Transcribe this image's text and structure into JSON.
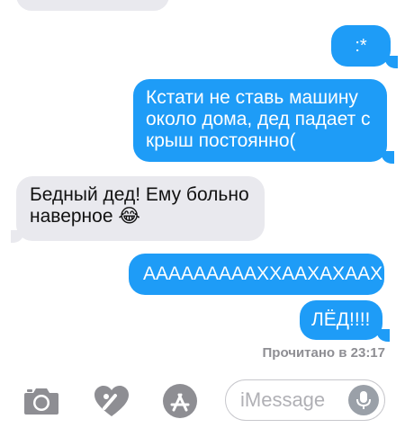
{
  "messages": [
    {
      "id": "top",
      "text": "",
      "direction": "incoming"
    },
    {
      "id": "emoji",
      "text": ":*",
      "direction": "outgoing"
    },
    {
      "id": "katati",
      "text": "Кстати не ставь машину около дома, дед падает с крыш постоянно(",
      "direction": "outgoing"
    },
    {
      "id": "ded",
      "text": "Бедный дед! Ему больно наверное 😂",
      "direction": "incoming"
    },
    {
      "id": "aaa",
      "text": "АААААААААХХААХАХААХ",
      "direction": "outgoing"
    },
    {
      "id": "led",
      "text": "ЛЁД!!!!",
      "direction": "outgoing"
    }
  ],
  "read_receipt": "Прочитано в 23:17",
  "composer": {
    "placeholder": "iMessage",
    "icons": [
      "camera-icon",
      "digital-touch-icon",
      "app-store-icon",
      "microphone-icon"
    ]
  },
  "colors": {
    "outgoing_bubble": "#1e9cf7",
    "incoming_bubble": "#e9e9ee",
    "icon_gray": "#8e8e93"
  }
}
